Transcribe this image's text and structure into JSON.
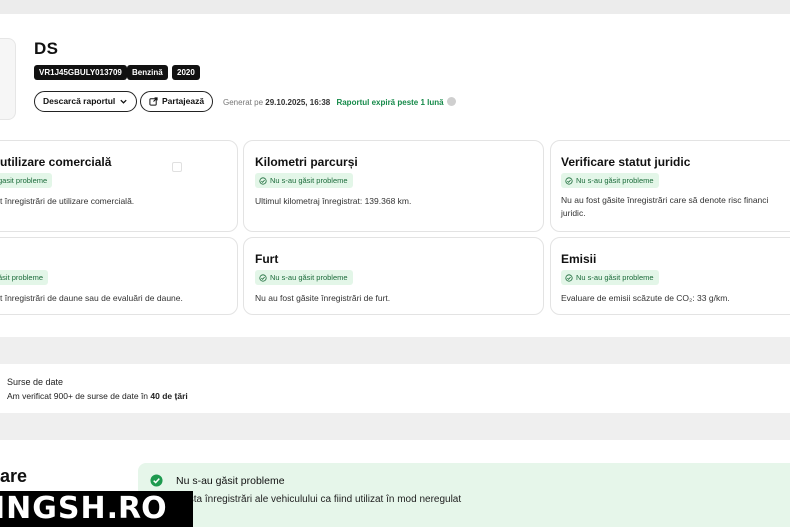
{
  "report": {
    "title": "DS",
    "tags": [
      "VR1J45GBULY013709",
      "Benzină",
      "2020"
    ],
    "download_label": "Descarcă raportul",
    "share_label": "Partajează",
    "generated_prefix": "Generat pe",
    "generated_date": "29.10.2025, 16:38",
    "expiry_text": "Raportul expiră peste 1 lună"
  },
  "cards": [
    {
      "title": "utilizare comercială",
      "badge": "gasit probleme",
      "text": "t înregistrări de utilizare comercială."
    },
    {
      "title": "Kilometri parcurși",
      "badge": "Nu s-au găsit probleme",
      "text": "Ultimul kilometraj înregistrat: 139.368 km."
    },
    {
      "title": "Verificare statut juridic",
      "badge": "Nu s-au găsit probleme",
      "text": "Nu au fost găsite înregistrări care să denote risc financi"
    },
    {
      "title": "",
      "badge": "ăsit probleme",
      "text": "t înregistrări de daune sau de evaluări de daune."
    },
    {
      "title": "Furt",
      "badge": "Nu s-au găsit probleme",
      "text": "Nu au fost găsite înregistrări de furt."
    },
    {
      "title": "Emisii",
      "badge": "Nu s-au găsit probleme",
      "text": "Evaluare de emisii scăzute de CO₂: 33 g/km."
    }
  ],
  "legal_text_line2": "juridic.",
  "sources": {
    "title": "Surse de date",
    "text_prefix": "Am verificat 900+ de surse de date în",
    "text_bold": "40 de țări"
  },
  "bottom": {
    "section_label": "are",
    "result_title": "Nu s-au găsit probleme",
    "result_text": "exista înregistrări ale vehiculului ca fiind utilizat în mod neregulat"
  },
  "watermark": {
    "part1": "INGSH",
    "part2": ".RO"
  },
  "colors": {
    "badge_bg": "#e3f6e8",
    "badge_fg": "#1b6b3a",
    "accent_green": "#168a4a"
  }
}
